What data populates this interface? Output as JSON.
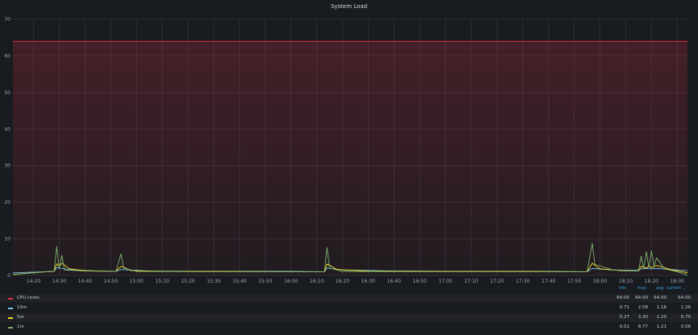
{
  "chart_data": {
    "type": "line",
    "title": "System Load",
    "ylim": [
      0,
      70
    ],
    "yticks": [
      0,
      10,
      20,
      30,
      40,
      50,
      60,
      70
    ],
    "xlim": [
      "14:12",
      "18:34"
    ],
    "xticks": [
      "14:20",
      "14:30",
      "14:40",
      "14:50",
      "15:00",
      "15:10",
      "15:20",
      "15:30",
      "15:40",
      "15:50",
      "16:00",
      "16:10",
      "16:20",
      "16:30",
      "16:40",
      "16:50",
      "17:00",
      "17:10",
      "17:20",
      "17:30",
      "17:40",
      "17:50",
      "18:00",
      "18:10",
      "18:20",
      "18:30"
    ],
    "grid": true,
    "legend_position": "bottom",
    "legend_columns": [
      "min",
      "max",
      "avg",
      "current"
    ],
    "series": [
      {
        "name": "CPU cores",
        "color": "#e02f44",
        "fill": true,
        "points": [
          [
            "14:12",
            64
          ],
          [
            "18:34",
            64
          ]
        ],
        "stats": {
          "min": "64.00",
          "max": "64.00",
          "avg": "64.00",
          "current": "64.00"
        }
      },
      {
        "name": "15m",
        "color": "#73bfe8",
        "points": [
          [
            "14:12",
            0.7
          ],
          [
            "14:25",
            1.0
          ],
          [
            "14:28",
            1.1
          ],
          [
            "14:29",
            2.1
          ],
          [
            "14:35",
            1.5
          ],
          [
            "14:45",
            1.2
          ],
          [
            "14:52",
            1.1
          ],
          [
            "14:54",
            1.6
          ],
          [
            "15:05",
            1.2
          ],
          [
            "15:30",
            1.1
          ],
          [
            "16:00",
            1.1
          ],
          [
            "16:13",
            1.0
          ],
          [
            "16:14",
            2.0
          ],
          [
            "16:20",
            1.5
          ],
          [
            "16:40",
            1.2
          ],
          [
            "17:00",
            1.1
          ],
          [
            "17:30",
            1.1
          ],
          [
            "17:55",
            1.0
          ],
          [
            "17:57",
            1.9
          ],
          [
            "18:05",
            1.5
          ],
          [
            "18:14",
            1.4
          ],
          [
            "18:16",
            1.8
          ],
          [
            "18:18",
            1.9
          ],
          [
            "18:20",
            1.8
          ],
          [
            "18:22",
            1.9
          ],
          [
            "18:30",
            1.5
          ],
          [
            "18:34",
            1.26
          ]
        ],
        "stats": {
          "min": "0.71",
          "max": "2.08",
          "avg": "1.16",
          "current": "1.26"
        }
      },
      {
        "name": "5m",
        "color": "#fade2a",
        "points": [
          [
            "14:12",
            0.3
          ],
          [
            "14:25",
            1.0
          ],
          [
            "14:28",
            1.1
          ],
          [
            "14:29",
            3.2
          ],
          [
            "14:30",
            2.4
          ],
          [
            "14:31",
            3.3
          ],
          [
            "14:34",
            1.8
          ],
          [
            "14:40",
            1.3
          ],
          [
            "14:52",
            1.1
          ],
          [
            "14:54",
            2.5
          ],
          [
            "14:58",
            1.3
          ],
          [
            "15:10",
            1.1
          ],
          [
            "15:30",
            1.1
          ],
          [
            "16:00",
            1.0
          ],
          [
            "16:13",
            1.0
          ],
          [
            "16:14",
            3.1
          ],
          [
            "16:18",
            1.6
          ],
          [
            "16:30",
            1.2
          ],
          [
            "17:00",
            1.1
          ],
          [
            "17:30",
            1.1
          ],
          [
            "17:55",
            1.0
          ],
          [
            "17:57",
            3.3
          ],
          [
            "18:00",
            1.8
          ],
          [
            "18:08",
            1.3
          ],
          [
            "18:15",
            1.2
          ],
          [
            "18:16",
            2.5
          ],
          [
            "18:18",
            2.0
          ],
          [
            "18:19",
            2.6
          ],
          [
            "18:20",
            2.1
          ],
          [
            "18:22",
            2.7
          ],
          [
            "18:28",
            1.5
          ],
          [
            "18:34",
            0.7
          ]
        ],
        "stats": {
          "min": "0.27",
          "max": "3.30",
          "avg": "1.20",
          "current": "0.70"
        }
      },
      {
        "name": "1m",
        "color": "#7eb26d",
        "points": [
          [
            "14:12",
            0.2
          ],
          [
            "14:25",
            1.0
          ],
          [
            "14:28",
            1.1
          ],
          [
            "14:29",
            7.9
          ],
          [
            "14:30",
            1.8
          ],
          [
            "14:31",
            5.5
          ],
          [
            "14:32",
            1.5
          ],
          [
            "14:40",
            1.2
          ],
          [
            "14:52",
            1.1
          ],
          [
            "14:54",
            5.9
          ],
          [
            "14:55",
            2.0
          ],
          [
            "15:00",
            1.1
          ],
          [
            "15:30",
            1.0
          ],
          [
            "16:00",
            1.0
          ],
          [
            "16:13",
            1.0
          ],
          [
            "16:14",
            7.6
          ],
          [
            "16:15",
            2.0
          ],
          [
            "16:20",
            1.1
          ],
          [
            "17:00",
            1.0
          ],
          [
            "17:30",
            1.0
          ],
          [
            "17:55",
            1.0
          ],
          [
            "17:57",
            8.77
          ],
          [
            "17:58",
            3.0
          ],
          [
            "18:05",
            1.5
          ],
          [
            "18:15",
            1.2
          ],
          [
            "18:16",
            5.3
          ],
          [
            "18:17",
            1.8
          ],
          [
            "18:18",
            6.5
          ],
          [
            "18:19",
            2.2
          ],
          [
            "18:20",
            6.7
          ],
          [
            "18:21",
            2.5
          ],
          [
            "18:22",
            4.8
          ],
          [
            "18:25",
            1.8
          ],
          [
            "18:30",
            1.0
          ],
          [
            "18:34",
            0.06
          ]
        ],
        "stats": {
          "min": "0.01",
          "max": "8.77",
          "avg": "1.21",
          "current": "0.06"
        }
      }
    ]
  }
}
